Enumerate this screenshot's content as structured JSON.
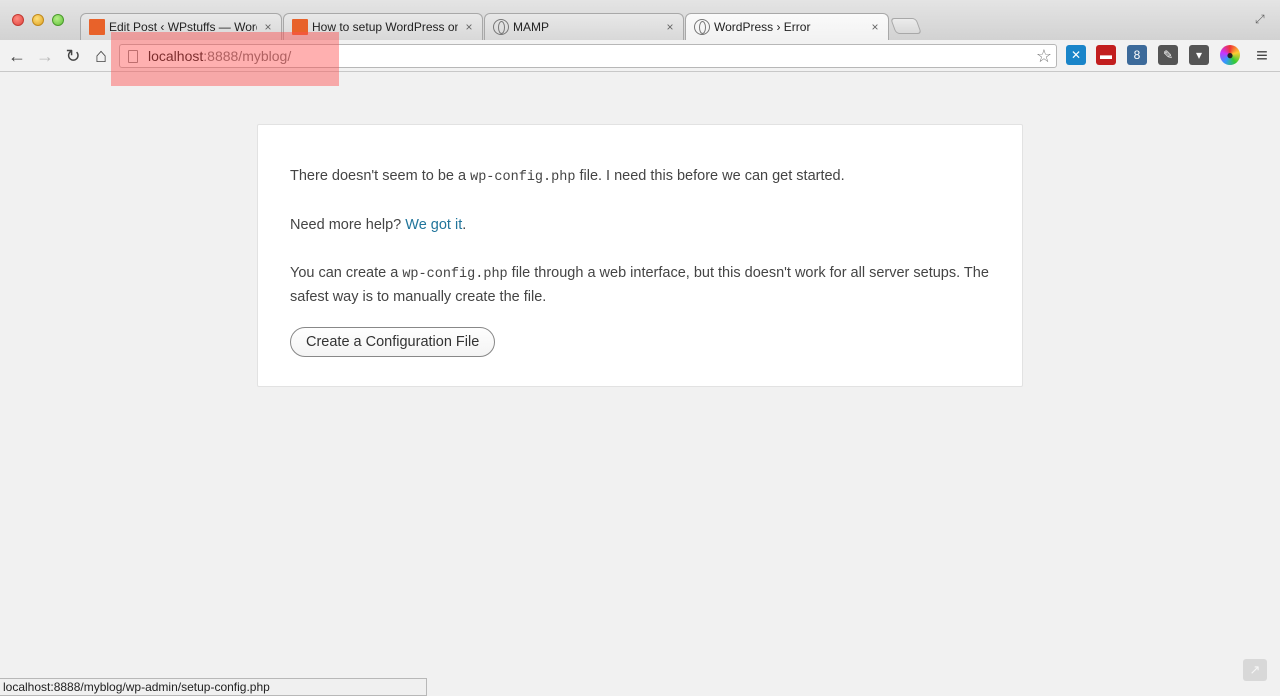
{
  "tabs": [
    {
      "title": "Edit Post ‹ WPstuffs — WordPress",
      "favicon": "wordpress-orange-icon",
      "close": "×"
    },
    {
      "title": "How to setup WordPress on Mac",
      "favicon": "wordpress-orange-icon",
      "close": "×"
    },
    {
      "title": "MAMP",
      "favicon": "globe-icon",
      "close": "×"
    },
    {
      "title": "WordPress › Error",
      "favicon": "globe-icon",
      "close": "×"
    }
  ],
  "toolbar": {
    "back": "←",
    "forward": "→",
    "reload": "↻",
    "home": "⌂",
    "bookmark_star": "☆",
    "menu": "≡"
  },
  "omnibox": {
    "host": "localhost",
    "rest": ":8888/myblog/"
  },
  "extensions": [
    {
      "name": "xmarks-icon",
      "color": "#1a85c9",
      "glyph": "✕"
    },
    {
      "name": "recliner-icon",
      "color": "#c21e1e",
      "glyph": "▬"
    },
    {
      "name": "user-badge-icon",
      "color": "#3c6a9a",
      "glyph": "8"
    },
    {
      "name": "pen-icon",
      "color": "#555555",
      "glyph": "✎"
    },
    {
      "name": "pocket-icon",
      "color": "#555555",
      "glyph": "▾"
    },
    {
      "name": "color-wheel-icon",
      "color": "#222222",
      "glyph": "●"
    }
  ],
  "content": {
    "p1_before": "There doesn't seem to be a ",
    "p1_code": "wp-config.php",
    "p1_after": " file. I need this before we can get started.",
    "p2_before": "Need more help? ",
    "p2_link": "We got it",
    "p2_after": ".",
    "p3_before": "You can create a ",
    "p3_code": "wp-config.php",
    "p3_after": " file through a web interface, but this doesn't work for all server setups. The safest way is to manually create the file.",
    "button": "Create a Configuration File"
  },
  "status_url": "localhost:8888/myblog/wp-admin/setup-config.php",
  "colors": {
    "link": "#21759b",
    "highlight": "#ff5050"
  }
}
